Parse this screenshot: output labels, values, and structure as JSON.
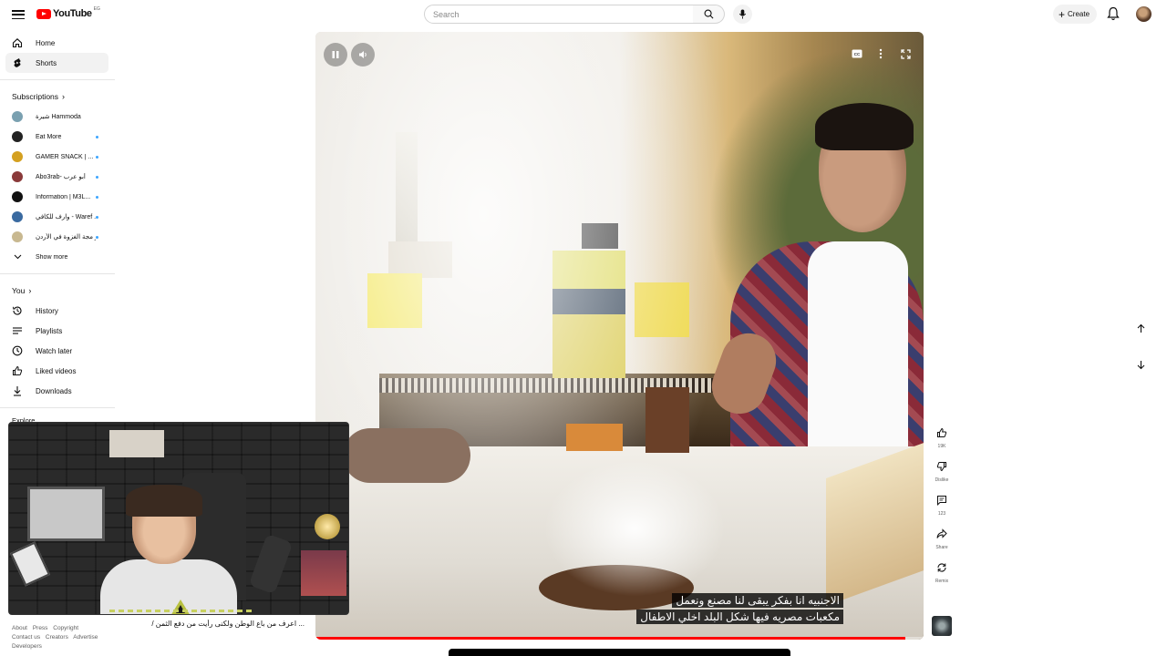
{
  "header": {
    "logo_text": "YouTube",
    "logo_country": "EG",
    "search_placeholder": "Search",
    "create_label": "Create"
  },
  "sidebar": {
    "main": [
      {
        "label": "Home",
        "icon": "home-icon"
      },
      {
        "label": "Shorts",
        "icon": "shorts-icon",
        "active": true
      }
    ],
    "subscriptions_title": "Subscriptions",
    "subscriptions": [
      {
        "name": "شيرة Hammoda",
        "color": "#7aa0b0",
        "live": false
      },
      {
        "name": "Eat More",
        "color": "#222222",
        "live": true
      },
      {
        "name": "GAMER SNACK | ...",
        "color": "#d4a020",
        "live": true
      },
      {
        "name": "Abo3rab- أبو عرب",
        "color": "#8a3a3a",
        "live": true
      },
      {
        "name": "Information | M3L...",
        "color": "#111111",
        "live": true
      },
      {
        "name": "وارف للكافي - Waref ...",
        "color": "#3a6aa0",
        "live": true
      },
      {
        "name": "بر مجة الغزوة في الأردن",
        "color": "#c8b890",
        "live": true
      }
    ],
    "show_more": "Show more",
    "you_title": "You",
    "you_items": [
      {
        "label": "History",
        "icon": "history-icon"
      },
      {
        "label": "Playlists",
        "icon": "playlists-icon"
      },
      {
        "label": "Watch later",
        "icon": "watch-later-icon"
      },
      {
        "label": "Liked videos",
        "icon": "like-icon"
      },
      {
        "label": "Downloads",
        "icon": "download-icon"
      }
    ],
    "explore_title": "Explore"
  },
  "footer": {
    "line1": [
      "About",
      "Press",
      "Copyright"
    ],
    "line2": [
      "Contact us",
      "Creators",
      "Advertise"
    ],
    "line3": [
      "Developers"
    ]
  },
  "short": {
    "title": "... اعرف من باع الوطن ولكنى رأيت من دفع الثمن /",
    "subtitle_line1": "الاجنبيه انا بفكر يبقى لنا مصنع ونعمل",
    "subtitle_line2": "مكعبات مصريه فيها شكل البلد اخلي الاطفال",
    "progress": 0.97,
    "actions": {
      "like_count": "19K",
      "dislike_label": "Dislike",
      "comment_count": "123",
      "share_label": "Share",
      "remix_label": "Remix"
    }
  },
  "colors": {
    "brand_red": "#ff0000",
    "live_dot": "#3ea6ff"
  }
}
